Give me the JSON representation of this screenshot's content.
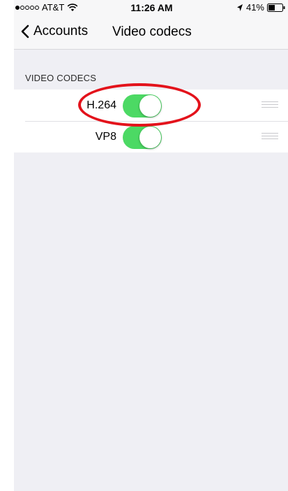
{
  "status_bar": {
    "carrier": "AT&T",
    "time": "11:26 AM",
    "battery_percent": "41%",
    "signal_bars_filled": 1,
    "signal_bars_total": 5
  },
  "nav": {
    "back_label": "Accounts",
    "title": "Video codecs"
  },
  "section": {
    "header": "VIDEO CODECS"
  },
  "codecs": [
    {
      "label": "H.264",
      "enabled": true,
      "highlighted": true
    },
    {
      "label": "VP8",
      "enabled": true,
      "highlighted": false
    }
  ],
  "colors": {
    "toggle_on": "#4cd964",
    "annotation": "#e3121b",
    "background": "#efeff4"
  },
  "icons": {
    "back": "chevron-left-icon",
    "wifi": "wifi-icon",
    "location": "location-arrow-icon",
    "battery": "battery-icon",
    "reorder": "reorder-handle-icon"
  }
}
